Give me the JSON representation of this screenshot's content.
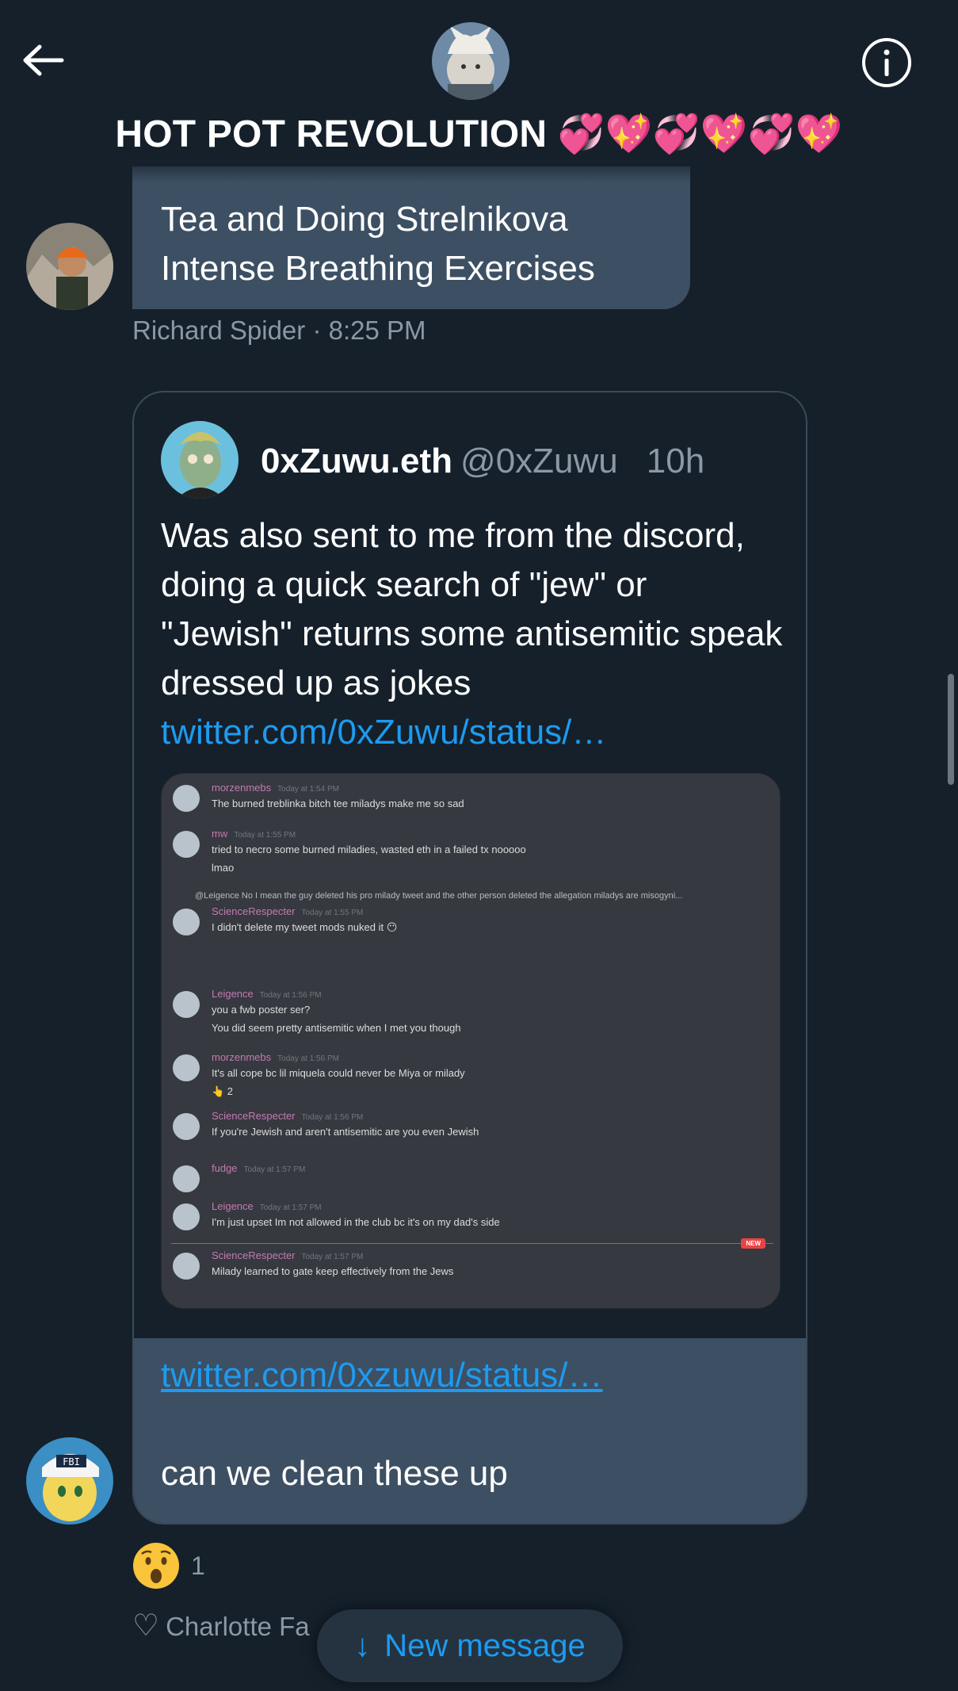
{
  "header": {
    "title": "HOT POT REVOLUTION 💞💖💞💖💞💖",
    "back_label": "Back",
    "info_label": "Info"
  },
  "message1": {
    "text": "Tea and Doing Strelnikova Intense Breathing Exercises",
    "meta": "Richard Spider · 8:25 PM"
  },
  "quoted_tweet": {
    "name": "0xZuwu.eth",
    "handle": "@0xZuwu",
    "time": "10h",
    "text": "Was also sent to me from the discord, doing a quick search of \"jew\" or \"Jewish\" returns some antisemitic speak dressed up as jokes ",
    "link": "twitter.com/0xZuwu/status/…",
    "media": {
      "messages": [
        {
          "name": "morzenmebs",
          "time": "Today at 1:54 PM",
          "lines": [
            "The burned treblinka bitch tee miladys make me so sad"
          ]
        },
        {
          "name": "mw",
          "time": "Today at 1:55 PM",
          "lines": [
            "tried to necro some burned miladies, wasted eth in a failed tx nooooo",
            "lmao"
          ]
        },
        {
          "reply": "@Leigence No I mean the guy deleted his pro milady tweet and the other person deleted the allegation miladys are misogyni...",
          "name": "ScienceRespecter",
          "time": "Today at 1:55 PM",
          "lines": [
            "I didn't delete my tweet mods nuked it 😶"
          ]
        },
        {
          "name": "Leigence",
          "time": "Today at 1:56 PM",
          "lines": [
            "you a fwb poster ser?",
            "You did seem pretty antisemitic when I met you though"
          ]
        },
        {
          "name": "morzenmebs",
          "time": "Today at 1:56 PM",
          "lines": [
            "It's all cope bc lil miquela could never be Miya or milady"
          ],
          "reaction": "👆 2"
        },
        {
          "name": "ScienceRespecter",
          "time": "Today at 1:56 PM",
          "lines": [
            "If you're Jewish and aren't antisemitic are you even Jewish"
          ]
        },
        {
          "name": "fudge",
          "time": "Today at 1:57 PM",
          "lines": []
        },
        {
          "name": "Leigence",
          "time": "Today at 1:57 PM",
          "lines": [
            "I'm just upset Im not allowed in the club bc it's on my dad's side"
          ]
        },
        {
          "name": "ScienceRespecter",
          "time": "Today at 1:57 PM",
          "lines": [
            "Milady learned to gate keep effectively from the Jews"
          ]
        }
      ],
      "new_badge": "NEW"
    }
  },
  "reply": {
    "link": "twitter.com/0xzuwu/status/…",
    "text": "can we clean these up"
  },
  "reaction": {
    "emoji": "😲",
    "count": "1"
  },
  "meta2": {
    "heart": "♡",
    "text": "Charlotte Fa"
  },
  "new_message_button": {
    "arrow": "↓",
    "label": "New message"
  },
  "colors": {
    "background": "#15202b",
    "bubble": "#3d4f63",
    "accent": "#1d9bf0",
    "muted": "#8b98a5"
  }
}
